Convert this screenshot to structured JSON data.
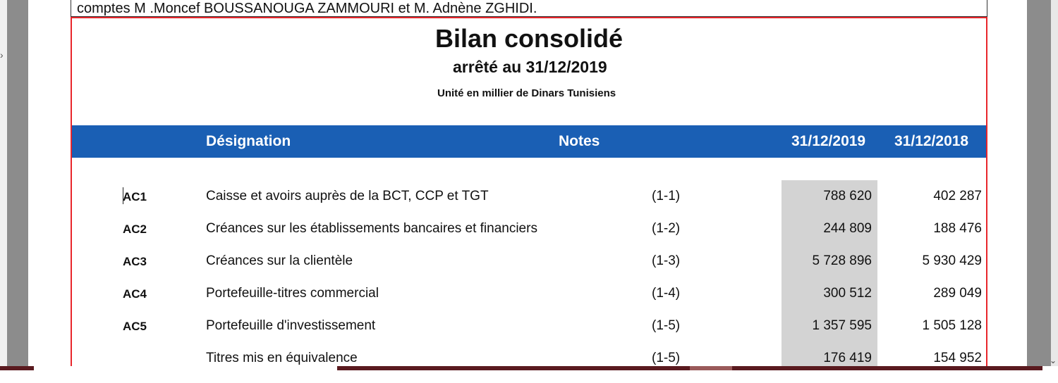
{
  "previous_text": "comptes M .Moncef BOUSSANOUGA ZAMMOURI et M. Adnène ZGHIDI.",
  "document": {
    "title": "Bilan consolidé",
    "subtitle": "arrêté au 31/12/2019",
    "unit": "Unité en millier de Dinars Tunisiens"
  },
  "table": {
    "headers": {
      "designation": "Désignation",
      "notes": "Notes",
      "year1": "31/12/2019",
      "year2": "31/12/2018"
    },
    "rows": [
      {
        "code": "AC1",
        "label": "Caisse et avoirs auprès de la BCT, CCP et TGT",
        "note": "(1-1)",
        "v2019": "788 620",
        "v2018": "402 287"
      },
      {
        "code": "AC2",
        "label": "Créances sur les établissements bancaires et financiers",
        "note": "(1-2)",
        "v2019": "244 809",
        "v2018": "188 476"
      },
      {
        "code": "AC3",
        "label": "Créances sur la clientèle",
        "note": "(1-3)",
        "v2019": "5 728 896",
        "v2018": "5 930 429"
      },
      {
        "code": "AC4",
        "label": "Portefeuille-titres commercial",
        "note": "(1-4)",
        "v2019": "300 512",
        "v2018": "289 049"
      },
      {
        "code": "AC5",
        "label": "Portefeuille d'investissement",
        "note": "(1-5)",
        "v2019": "1 357 595",
        "v2018": "1 505 128"
      },
      {
        "code": "",
        "label": "Titres mis en équivalence",
        "note": "(1-5)",
        "v2019": "176 419",
        "v2018": "154 952"
      }
    ]
  },
  "colors": {
    "header_band": "#1a5fb4",
    "frame_border": "#e8262b",
    "shade": "#d3d3d3"
  }
}
